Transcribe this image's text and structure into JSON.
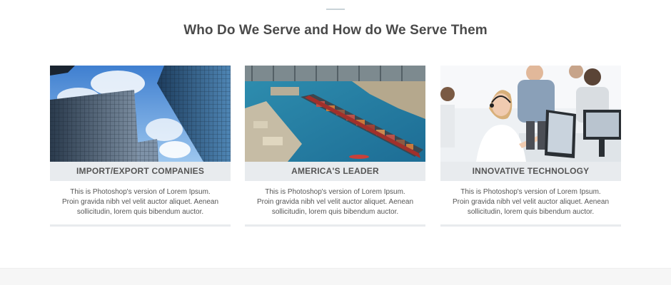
{
  "section": {
    "title": "Who Do We Serve and How do We Serve Them"
  },
  "cards": [
    {
      "label": "IMPORT/EXPORT COMPANIES",
      "image": "office-skyscrapers-photo",
      "text": [
        "This is Photoshop's version of Lorem Ipsum.",
        "Proin gravida nibh vel velit auctor aliquet. Aenean",
        "sollicitudin, lorem quis bibendum auctor."
      ]
    },
    {
      "label": "AMERICA'S LEADER",
      "image": "container-ship-port-photo",
      "text": [
        "This is Photoshop's version of Lorem Ipsum.",
        "Proin gravida nibh vel velit auctor aliquet. Aenean",
        "sollicitudin, lorem quis bibendum auctor."
      ]
    },
    {
      "label": "INNOVATIVE TECHNOLOGY",
      "image": "call-center-office-photo",
      "text": [
        "This is Photoshop's version of Lorem Ipsum.",
        "Proin gravida nibh vel velit auctor aliquet. Aenean",
        "sollicitudin, lorem quis bibendum auctor."
      ]
    }
  ],
  "colors": {
    "title": "#4a4a4a",
    "label_bar": "#e8ebee",
    "body_text": "#555555",
    "divider": "#c9d3d8"
  }
}
